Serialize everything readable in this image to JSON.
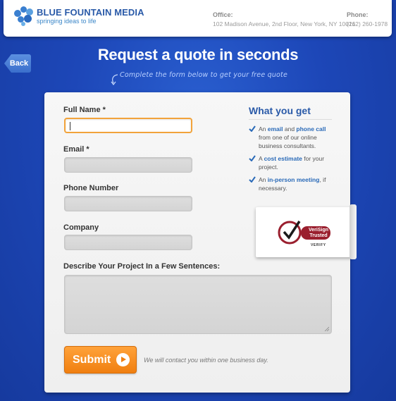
{
  "header": {
    "brand": "BLUE FOUNTAIN MEDIA",
    "tagline": "springing ideas to life",
    "office_label": "Office:",
    "office_address": "102 Madison Avenue, 2nd Floor, New York, NY 10016",
    "phone_label": "Phone:",
    "phone_number": "(212) 260-1978"
  },
  "nav": {
    "back_label": "Back"
  },
  "page": {
    "title": "Request a quote in seconds",
    "subtitle": "Complete the form below to get your free quote"
  },
  "form": {
    "full_name_label": "Full Name *",
    "email_label": "Email *",
    "phone_label": "Phone Number",
    "company_label": "Company",
    "project_label": "Describe Your Project In a Few Sentences:",
    "full_name_value": "",
    "email_value": "",
    "phone_value": "",
    "company_value": "",
    "project_value": "",
    "submit_label": "Submit",
    "contact_note": "We will contact you within one business day."
  },
  "sidebar": {
    "title": "What you get",
    "benefits": [
      {
        "pre": "An ",
        "hl1": "email",
        "mid": " and ",
        "hl2": "phone call",
        "post": " from one of our online business consultants."
      },
      {
        "pre": "A ",
        "hl1": "cost estimate",
        "post": " for your project."
      },
      {
        "pre": "An ",
        "hl1": "in-person meeting",
        "post": ", if necessary."
      }
    ],
    "badge_text": "VeriSign Trusted",
    "badge_verify": "VERIFY"
  },
  "colors": {
    "accent": "#2a5aa8",
    "submit": "#f07f10",
    "focus_border": "#f2a33a",
    "background": "#1d47b8"
  }
}
